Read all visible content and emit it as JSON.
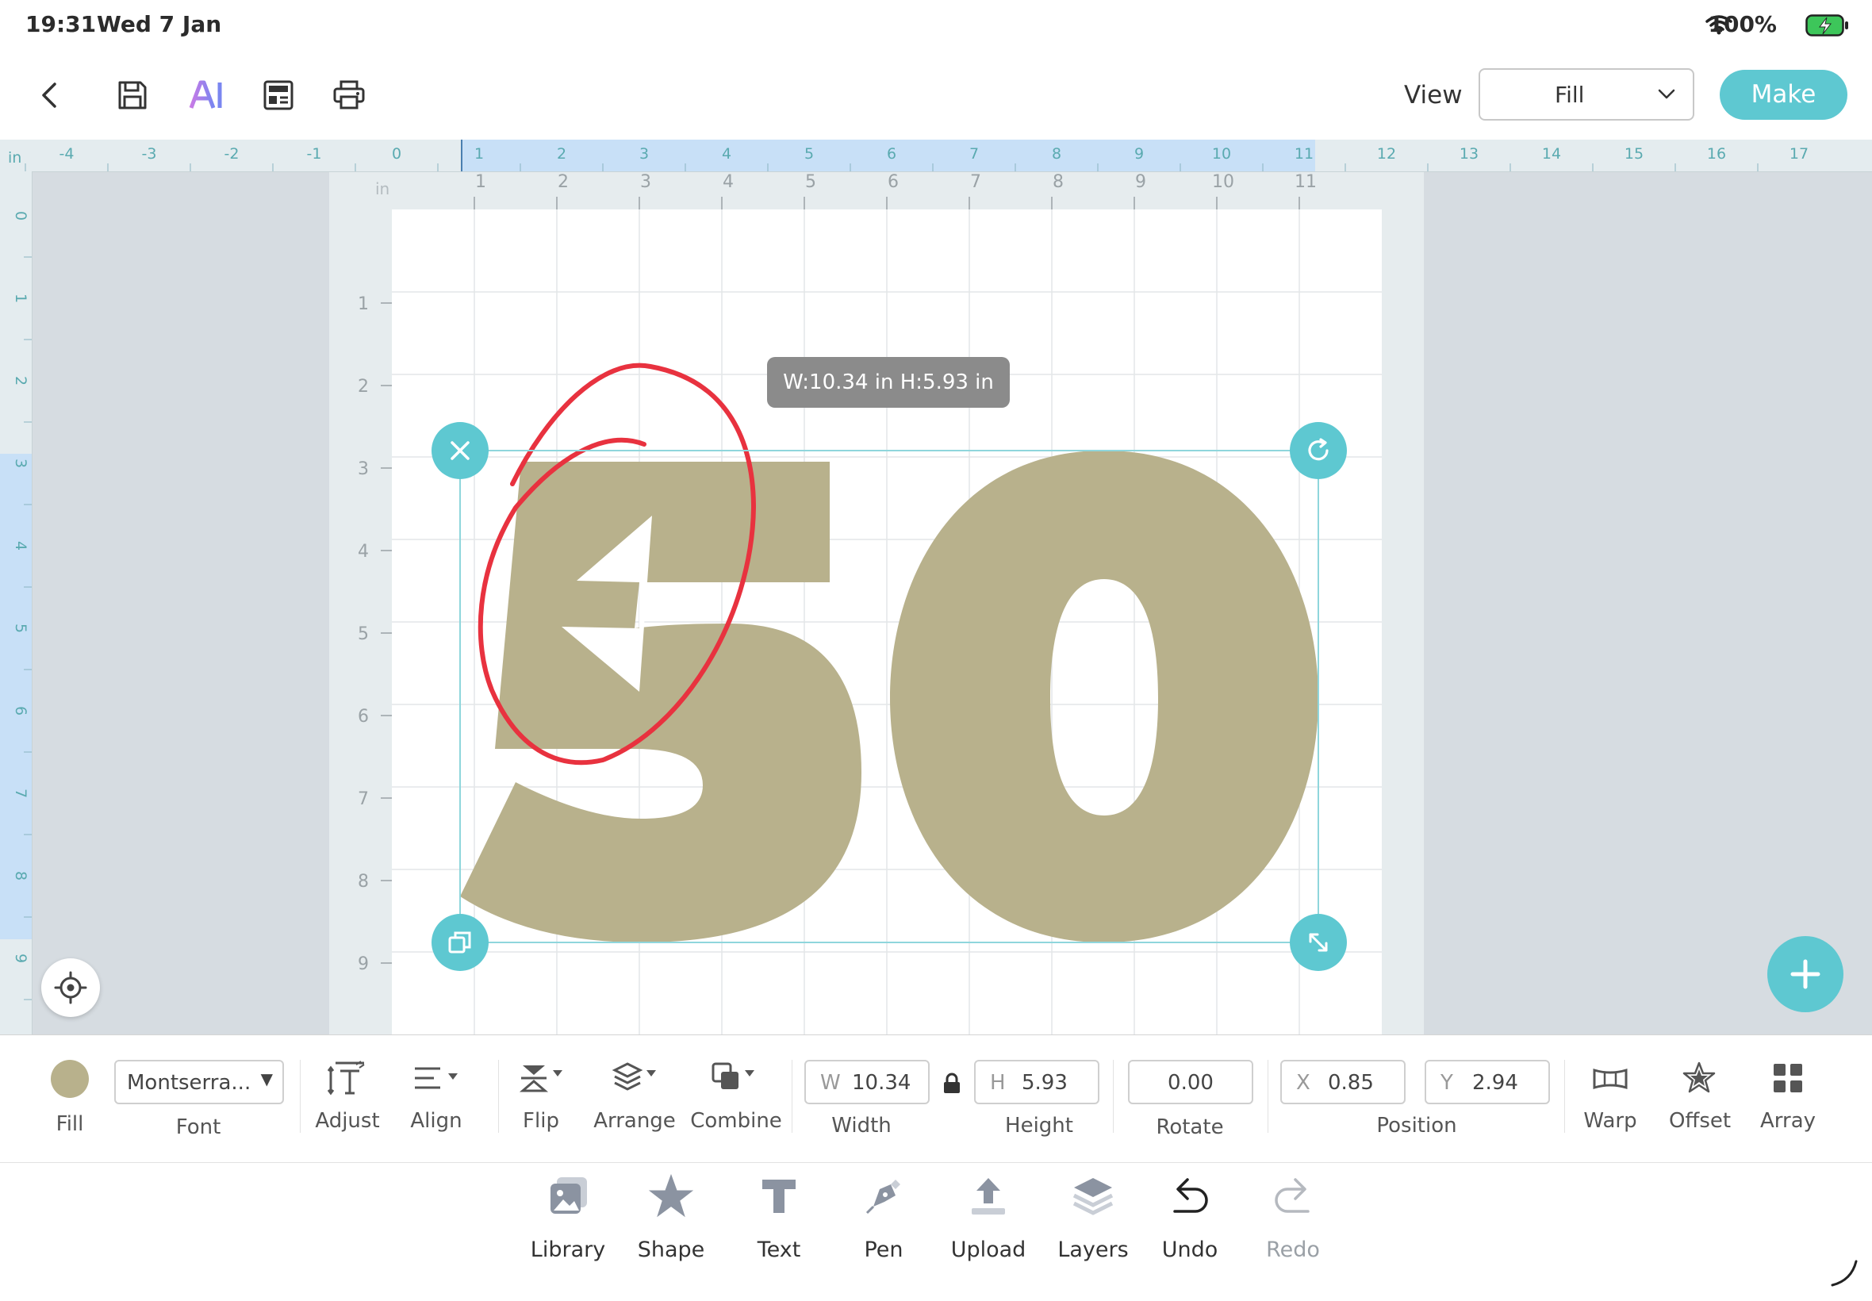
{
  "status_bar": {
    "time": "19:31",
    "date": "Wed 7 Jan",
    "battery": "100%"
  },
  "top_bar": {
    "view_label": "View",
    "view_value": "Fill",
    "make_label": "Make"
  },
  "ruler": {
    "unit": "in",
    "top_outer": [
      "-4",
      "-3",
      "-2",
      "-1",
      "0",
      "1",
      "2",
      "3",
      "4",
      "5",
      "6",
      "7",
      "8",
      "9",
      "10",
      "11",
      "12",
      "13",
      "14",
      "15",
      "16",
      "17"
    ],
    "top_inner": [
      "1",
      "2",
      "3",
      "4",
      "5",
      "6",
      "7",
      "8",
      "9",
      "10",
      "11"
    ],
    "left_outer": [
      "0",
      "1",
      "2",
      "3",
      "4",
      "5",
      "6",
      "7",
      "8",
      "9"
    ],
    "left_inner": [
      "1",
      "2",
      "3",
      "4",
      "5",
      "6",
      "7",
      "8",
      "9"
    ]
  },
  "canvas": {
    "mat_unit": "in",
    "size_tooltip": "W:10.34 in  H:5.93 in",
    "design_text": "50",
    "fill_color": "#b8b18c",
    "annotation_color": "#e8323f"
  },
  "edit_toolbar": {
    "fill_label": "Fill",
    "fill_color": "#b8b18c",
    "font_value": "Montserra...",
    "font_label": "Font",
    "adjust_label": "Adjust",
    "align_label": "Align",
    "flip_label": "Flip",
    "arrange_label": "Arrange",
    "combine_label": "Combine",
    "width_prefix": "W",
    "width_value": "10.34",
    "width_label": "Width",
    "height_prefix": "H",
    "height_value": "5.93",
    "height_label": "Height",
    "rotate_value": "0.00",
    "rotate_label": "Rotate",
    "x_prefix": "X",
    "x_value": "0.85",
    "y_prefix": "Y",
    "y_value": "2.94",
    "position_label": "Position",
    "warp_label": "Warp",
    "offset_label": "Offset",
    "array_label": "Array"
  },
  "bottom_nav": {
    "library": "Library",
    "shape": "Shape",
    "text": "Text",
    "pen": "Pen",
    "upload": "Upload",
    "layers": "Layers",
    "undo": "Undo",
    "redo": "Redo"
  },
  "accent_color": "#5ec8d1"
}
